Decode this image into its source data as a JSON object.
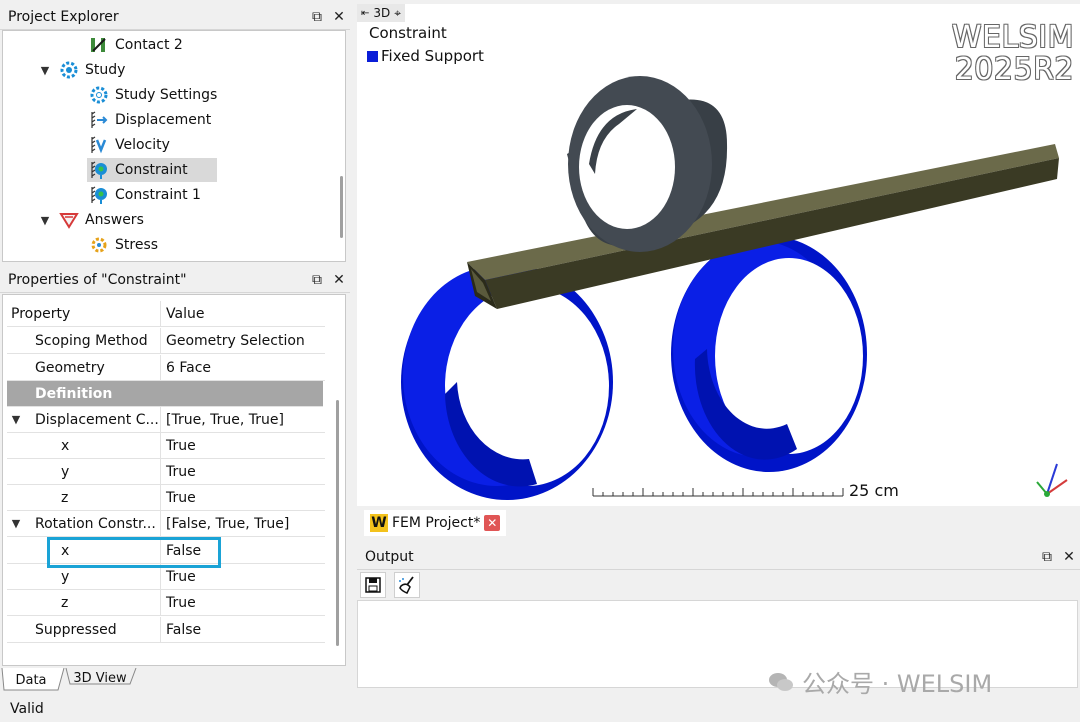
{
  "explorer": {
    "title": "Project Explorer",
    "items": [
      {
        "label": "Contact 2",
        "icon": "contact-icon"
      },
      {
        "label": "Study",
        "icon": "study-gear-icon"
      },
      {
        "label": "Study Settings",
        "icon": "gear-icon"
      },
      {
        "label": "Displacement",
        "icon": "displacement-icon"
      },
      {
        "label": "Velocity",
        "icon": "velocity-icon"
      },
      {
        "label": "Constraint",
        "icon": "constraint-icon"
      },
      {
        "label": "Constraint 1",
        "icon": "constraint-icon"
      },
      {
        "label": "Answers",
        "icon": "answers-icon"
      },
      {
        "label": "Stress",
        "icon": "stress-icon"
      }
    ]
  },
  "properties": {
    "title": "Properties of \"Constraint\"",
    "header_key": "Property",
    "header_value": "Value",
    "rows": [
      {
        "key": "Scoping Method",
        "value": "Geometry Selection"
      },
      {
        "key": "Geometry",
        "value": "6 Face"
      },
      {
        "key": "Definition",
        "value": ""
      },
      {
        "key": "Displacement C...",
        "value": "[True, True, True]"
      },
      {
        "key": "x",
        "value": "True"
      },
      {
        "key": "y",
        "value": "True"
      },
      {
        "key": "z",
        "value": "True"
      },
      {
        "key": "Rotation Constr...",
        "value": "[False, True, True]"
      },
      {
        "key": "x",
        "value": "False"
      },
      {
        "key": "y",
        "value": "True"
      },
      {
        "key": "z",
        "value": "True"
      },
      {
        "key": "Suppressed",
        "value": "False"
      }
    ]
  },
  "bottom_tabs": [
    "Data",
    "3D View"
  ],
  "viewport": {
    "tag": "3D",
    "legend_title": "Constraint",
    "legend_item": "Fixed Support",
    "legend_color": "#0a1dd8",
    "brand_line1": "WELSIM",
    "brand_line2": "2025R2",
    "scale_label": "25 cm"
  },
  "doc_tab": {
    "icon_letter": "W",
    "label": "FEM Project*"
  },
  "output": {
    "title": "Output"
  },
  "status": "Valid",
  "watermark": "公众号 · WELSIM"
}
